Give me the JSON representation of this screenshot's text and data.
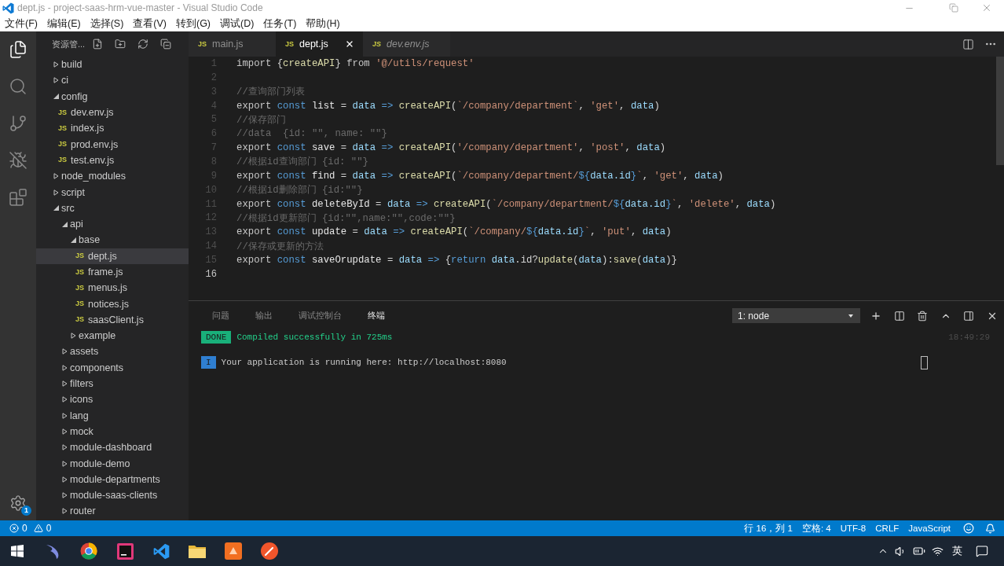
{
  "window": {
    "title": "dept.js - project-saas-hrm-vue-master - Visual Studio Code"
  },
  "menu": [
    "文件(F)",
    "编辑(E)",
    "选择(S)",
    "查看(V)",
    "转到(G)",
    "调试(D)",
    "任务(T)",
    "帮助(H)"
  ],
  "activity_bar": {
    "items": [
      {
        "kind": "explorer",
        "selected": true
      },
      {
        "kind": "search",
        "selected": false
      },
      {
        "kind": "source-control",
        "selected": false
      },
      {
        "kind": "debug",
        "selected": false
      },
      {
        "kind": "extensions",
        "selected": false
      }
    ],
    "settings_badge": "1"
  },
  "sidebar": {
    "title": "资源管...",
    "tree": [
      {
        "label": "build",
        "kind": "folder",
        "expanded": false,
        "selected": false
      },
      {
        "label": "ci",
        "kind": "folder",
        "expanded": false,
        "selected": false
      },
      {
        "label": "config",
        "kind": "folder",
        "expanded": true,
        "selected": false,
        "children": [
          {
            "label": "dev.env.js",
            "kind": "file",
            "icon_label": "JS",
            "selected": false
          },
          {
            "label": "index.js",
            "kind": "file",
            "icon_label": "JS",
            "selected": false
          },
          {
            "label": "prod.env.js",
            "kind": "file",
            "icon_label": "JS",
            "selected": false
          },
          {
            "label": "test.env.js",
            "kind": "file",
            "icon_label": "JS",
            "selected": false
          }
        ]
      },
      {
        "label": "node_modules",
        "kind": "folder",
        "expanded": false,
        "selected": false
      },
      {
        "label": "script",
        "kind": "folder",
        "expanded": false,
        "selected": false
      },
      {
        "label": "src",
        "kind": "folder",
        "expanded": true,
        "selected": false,
        "children": [
          {
            "label": "api",
            "kind": "folder",
            "expanded": true,
            "selected": false,
            "children": [
              {
                "label": "base",
                "kind": "folder",
                "expanded": true,
                "selected": false,
                "children": [
                  {
                    "label": "dept.js",
                    "kind": "file",
                    "icon_label": "JS",
                    "selected": true
                  },
                  {
                    "label": "frame.js",
                    "kind": "file",
                    "icon_label": "JS",
                    "selected": false
                  },
                  {
                    "label": "menus.js",
                    "kind": "file",
                    "icon_label": "JS",
                    "selected": false
                  },
                  {
                    "label": "notices.js",
                    "kind": "file",
                    "icon_label": "JS",
                    "selected": false
                  },
                  {
                    "label": "saasClient.js",
                    "kind": "file",
                    "icon_label": "JS",
                    "selected": false
                  }
                ]
              },
              {
                "label": "example",
                "kind": "folder",
                "expanded": false,
                "selected": false
              }
            ]
          },
          {
            "label": "assets",
            "kind": "folder",
            "expanded": false,
            "selected": false
          },
          {
            "label": "components",
            "kind": "folder",
            "expanded": false,
            "selected": false
          },
          {
            "label": "filters",
            "kind": "folder",
            "expanded": false,
            "selected": false
          },
          {
            "label": "icons",
            "kind": "folder",
            "expanded": false,
            "selected": false
          },
          {
            "label": "lang",
            "kind": "folder",
            "expanded": false,
            "selected": false
          },
          {
            "label": "mock",
            "kind": "folder",
            "expanded": false,
            "selected": false
          },
          {
            "label": "module-dashboard",
            "kind": "folder",
            "expanded": false,
            "selected": false
          },
          {
            "label": "module-demo",
            "kind": "folder",
            "expanded": false,
            "selected": false
          },
          {
            "label": "module-departments",
            "kind": "folder",
            "expanded": false,
            "selected": false
          },
          {
            "label": "module-saas-clients",
            "kind": "folder",
            "expanded": false,
            "selected": false
          },
          {
            "label": "router",
            "kind": "folder",
            "expanded": false,
            "selected": false
          }
        ]
      }
    ]
  },
  "editor": {
    "tabs": [
      {
        "icon_label": "JS",
        "label": "main.js",
        "selected": false,
        "preview": false
      },
      {
        "icon_label": "JS",
        "label": "dept.js",
        "selected": true,
        "preview": false
      },
      {
        "icon_label": "JS",
        "label": "dev.env.js",
        "selected": false,
        "preview": true
      }
    ],
    "lines": [
      {
        "number": "1",
        "current": false,
        "tokens": [
          {
            "kind": "keyword",
            "text": "import"
          },
          {
            "kind": "plain",
            "text": " {"
          },
          {
            "kind": "function",
            "text": "createAPI"
          },
          {
            "kind": "plain",
            "text": "} "
          },
          {
            "kind": "keyword",
            "text": "from "
          },
          {
            "kind": "string",
            "text": "'@/utils/request'"
          }
        ]
      },
      {
        "number": "2",
        "current": false
      },
      {
        "number": "3",
        "current": false,
        "tokens": [
          {
            "kind": "comment",
            "text": "//查询部门列表"
          }
        ]
      },
      {
        "number": "4",
        "current": false,
        "tokens": [
          {
            "kind": "keyword",
            "text": "export "
          },
          {
            "kind": "storage",
            "text": "const "
          },
          {
            "kind": "variable",
            "text": "list"
          },
          {
            "kind": "plain",
            "text": " = "
          },
          {
            "kind": "param",
            "text": "data "
          },
          {
            "kind": "storage",
            "text": "=> "
          },
          {
            "kind": "function",
            "text": "createAPI"
          },
          {
            "kind": "plain",
            "text": "("
          },
          {
            "kind": "string",
            "text": "`/company/department`"
          },
          {
            "kind": "plain",
            "text": ", "
          },
          {
            "kind": "string",
            "text": "'get'"
          },
          {
            "kind": "plain",
            "text": ", "
          },
          {
            "kind": "param",
            "text": "data"
          },
          {
            "kind": "plain",
            "text": ")"
          }
        ]
      },
      {
        "number": "5",
        "current": false,
        "tokens": [
          {
            "kind": "comment",
            "text": "//保存部门"
          }
        ]
      },
      {
        "number": "6",
        "current": false,
        "tokens": [
          {
            "kind": "comment",
            "text": "//data  {id: \"\", name: \"\"}"
          }
        ]
      },
      {
        "number": "7",
        "current": false,
        "tokens": [
          {
            "kind": "keyword",
            "text": "export "
          },
          {
            "kind": "storage",
            "text": "const "
          },
          {
            "kind": "variable",
            "text": "save"
          },
          {
            "kind": "plain",
            "text": " = "
          },
          {
            "kind": "param",
            "text": "data "
          },
          {
            "kind": "storage",
            "text": "=> "
          },
          {
            "kind": "function",
            "text": "createAPI"
          },
          {
            "kind": "plain",
            "text": "("
          },
          {
            "kind": "string",
            "text": "'/company/department'"
          },
          {
            "kind": "plain",
            "text": ", "
          },
          {
            "kind": "string",
            "text": "'post'"
          },
          {
            "kind": "plain",
            "text": ", "
          },
          {
            "kind": "param",
            "text": "data"
          },
          {
            "kind": "plain",
            "text": ")"
          }
        ]
      },
      {
        "number": "8",
        "current": false,
        "tokens": [
          {
            "kind": "comment",
            "text": "//根据id查询部门 {id: \"\"}"
          }
        ]
      },
      {
        "number": "9",
        "current": false,
        "tokens": [
          {
            "kind": "keyword",
            "text": "export "
          },
          {
            "kind": "storage",
            "text": "const "
          },
          {
            "kind": "variable",
            "text": "find"
          },
          {
            "kind": "plain",
            "text": " = "
          },
          {
            "kind": "param",
            "text": "data "
          },
          {
            "kind": "storage",
            "text": "=> "
          },
          {
            "kind": "function",
            "text": "createAPI"
          },
          {
            "kind": "plain",
            "text": "("
          },
          {
            "kind": "string",
            "text": "`/company/department/"
          },
          {
            "kind": "template",
            "text": "${"
          },
          {
            "kind": "param",
            "text": "data.id"
          },
          {
            "kind": "template",
            "text": "}"
          },
          {
            "kind": "string",
            "text": "`"
          },
          {
            "kind": "plain",
            "text": ", "
          },
          {
            "kind": "string",
            "text": "'get'"
          },
          {
            "kind": "plain",
            "text": ", "
          },
          {
            "kind": "param",
            "text": "data"
          },
          {
            "kind": "plain",
            "text": ")"
          }
        ]
      },
      {
        "number": "10",
        "current": false,
        "tokens": [
          {
            "kind": "comment",
            "text": "//根据id删除部门 {id:\"\"}"
          }
        ]
      },
      {
        "number": "11",
        "current": false,
        "tokens": [
          {
            "kind": "keyword",
            "text": "export "
          },
          {
            "kind": "storage",
            "text": "const "
          },
          {
            "kind": "variable",
            "text": "deleteById"
          },
          {
            "kind": "plain",
            "text": " = "
          },
          {
            "kind": "param",
            "text": "data "
          },
          {
            "kind": "storage",
            "text": "=> "
          },
          {
            "kind": "function",
            "text": "createAPI"
          },
          {
            "kind": "plain",
            "text": "("
          },
          {
            "kind": "string",
            "text": "`/company/department/"
          },
          {
            "kind": "template",
            "text": "${"
          },
          {
            "kind": "param",
            "text": "data.id"
          },
          {
            "kind": "template",
            "text": "}"
          },
          {
            "kind": "string",
            "text": "`"
          },
          {
            "kind": "plain",
            "text": ", "
          },
          {
            "kind": "string",
            "text": "'delete'"
          },
          {
            "kind": "plain",
            "text": ", "
          },
          {
            "kind": "param",
            "text": "data"
          },
          {
            "kind": "plain",
            "text": ")"
          }
        ]
      },
      {
        "number": "12",
        "current": false,
        "tokens": [
          {
            "kind": "comment",
            "text": "//根据id更新部门 {id:\"\",name:\"\",code:\"\"}"
          }
        ]
      },
      {
        "number": "13",
        "current": false,
        "tokens": [
          {
            "kind": "keyword",
            "text": "export "
          },
          {
            "kind": "storage",
            "text": "const "
          },
          {
            "kind": "variable",
            "text": "update"
          },
          {
            "kind": "plain",
            "text": " = "
          },
          {
            "kind": "param",
            "text": "data "
          },
          {
            "kind": "storage",
            "text": "=> "
          },
          {
            "kind": "function",
            "text": "createAPI"
          },
          {
            "kind": "plain",
            "text": "("
          },
          {
            "kind": "string",
            "text": "`/company/"
          },
          {
            "kind": "template",
            "text": "${"
          },
          {
            "kind": "param",
            "text": "data.id"
          },
          {
            "kind": "template",
            "text": "}"
          },
          {
            "kind": "string",
            "text": "`"
          },
          {
            "kind": "plain",
            "text": ", "
          },
          {
            "kind": "string",
            "text": "'put'"
          },
          {
            "kind": "plain",
            "text": ", "
          },
          {
            "kind": "param",
            "text": "data"
          },
          {
            "kind": "plain",
            "text": ")"
          }
        ]
      },
      {
        "number": "14",
        "current": false,
        "tokens": [
          {
            "kind": "comment",
            "text": "//保存或更新的方法"
          }
        ]
      },
      {
        "number": "15",
        "current": false,
        "tokens": [
          {
            "kind": "keyword",
            "text": "export "
          },
          {
            "kind": "storage",
            "text": "const "
          },
          {
            "kind": "variable",
            "text": "saveOrupdate"
          },
          {
            "kind": "plain",
            "text": " = "
          },
          {
            "kind": "param",
            "text": "data "
          },
          {
            "kind": "storage",
            "text": "=>"
          },
          {
            "kind": "plain",
            "text": " {"
          },
          {
            "kind": "storage",
            "text": "return "
          },
          {
            "kind": "param",
            "text": "data"
          },
          {
            "kind": "plain",
            "text": ".id?"
          },
          {
            "kind": "function",
            "text": "update"
          },
          {
            "kind": "plain",
            "text": "("
          },
          {
            "kind": "param",
            "text": "data"
          },
          {
            "kind": "plain",
            "text": "):"
          },
          {
            "kind": "function",
            "text": "save"
          },
          {
            "kind": "plain",
            "text": "("
          },
          {
            "kind": "param",
            "text": "data"
          },
          {
            "kind": "plain",
            "text": ")}"
          }
        ]
      },
      {
        "number": "16",
        "current": true
      }
    ]
  },
  "panel": {
    "tabs": [
      {
        "label": "问题",
        "selected": false
      },
      {
        "label": "输出",
        "selected": false
      },
      {
        "label": "调试控制台",
        "selected": false
      },
      {
        "label": "终端",
        "selected": true
      }
    ],
    "terminal_select": "1: node",
    "terminal_lines": [
      {
        "kind": "done",
        "badge": "DONE",
        "text": "Compiled successfully in 725ms",
        "time": "18:49:29"
      },
      {
        "kind": "info",
        "badge": "I",
        "text": "Your application is running here: http://localhost:8080"
      }
    ]
  },
  "status_bar": {
    "errors": "0",
    "warnings": "0",
    "items": [
      "行 16，列 1",
      "空格: 4",
      "UTF-8",
      "CRLF",
      "JavaScript"
    ]
  },
  "taskbar": {
    "input_language": "英"
  }
}
